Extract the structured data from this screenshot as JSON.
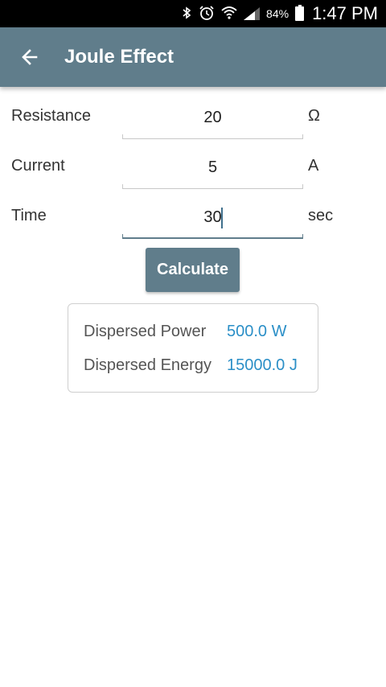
{
  "status_bar": {
    "icons": [
      "bluetooth-icon",
      "alarm-icon",
      "wifi-icon",
      "signal-icon"
    ],
    "battery": "84%",
    "time": "1:47 PM"
  },
  "app_bar": {
    "title": "Joule Effect",
    "back_icon": "arrow-left-icon"
  },
  "form": {
    "resistance": {
      "label": "Resistance",
      "value": "20",
      "unit": "Ω"
    },
    "current": {
      "label": "Current",
      "value": "5",
      "unit": "A"
    },
    "time": {
      "label": "Time",
      "value": "30",
      "unit": "sec"
    }
  },
  "calculate_label": "Calculate",
  "results": {
    "power": {
      "label": "Dispersed Power",
      "value": "500.0 W"
    },
    "energy": {
      "label": "Dispersed Energy",
      "value": "15000.0 J"
    }
  },
  "colors": {
    "primary": "#607d8b",
    "result_value": "#2b8fc7"
  }
}
